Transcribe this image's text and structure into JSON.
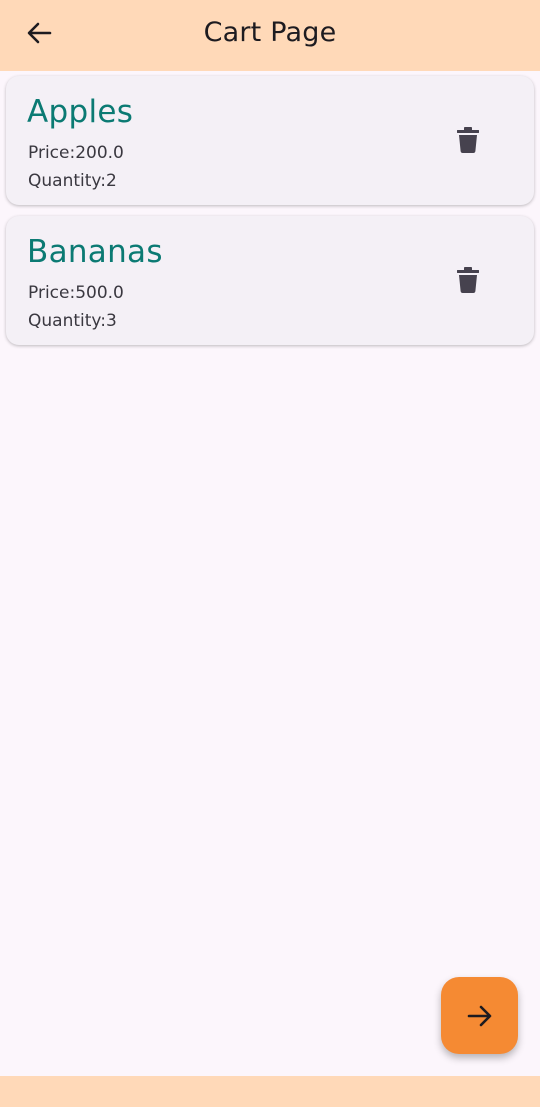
{
  "app_bar": {
    "title": "Cart Page",
    "back_icon": "arrow-back-icon",
    "background": "#ffd9b8"
  },
  "cart": {
    "price_prefix": "Price:",
    "quantity_prefix": "Quantity:",
    "items": [
      {
        "name": "Apples",
        "price": "Price:200.0",
        "quantity": "Quantity:2",
        "delete_icon": "trash-icon"
      },
      {
        "name": "Bananas",
        "price": "Price:500.0",
        "quantity": "Quantity:3",
        "delete_icon": "trash-icon"
      }
    ],
    "name_color": "#0b7a73",
    "card_color": "#f4f0f6"
  },
  "fab": {
    "icon": "arrow-forward-icon",
    "color": "#f58a33"
  },
  "colors": {
    "page_background": "#fcf6fc",
    "bottom_bar": "#ffd9b8"
  }
}
